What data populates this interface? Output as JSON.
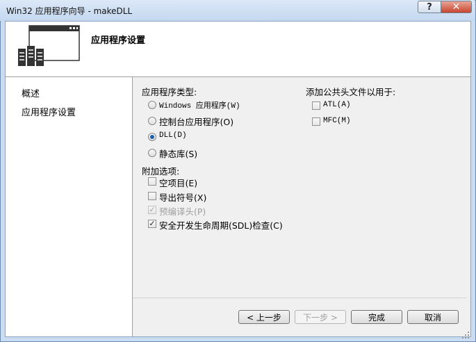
{
  "window": {
    "title": "Win32 应用程序向导 - makeDLL",
    "help_glyph": "?",
    "close_glyph": "✕"
  },
  "header": {
    "title": "应用程序设置"
  },
  "nav": {
    "items": [
      "概述",
      "应用程序设置"
    ]
  },
  "app_type": {
    "label": "应用程序类型:",
    "options": [
      {
        "label": "Windows 应用程序(W)",
        "selected": false
      },
      {
        "label": "控制台应用程序(O)",
        "selected": false
      },
      {
        "label": "DLL(D)",
        "selected": true
      },
      {
        "label": "静态库(S)",
        "selected": false
      }
    ]
  },
  "extra": {
    "label": "附加选项:",
    "options": [
      {
        "label": "空项目(E)",
        "checked": false,
        "enabled": true
      },
      {
        "label": "导出符号(X)",
        "checked": false,
        "enabled": true
      },
      {
        "label": "预编译头(P)",
        "checked": true,
        "enabled": false
      },
      {
        "label": "安全开发生命周期(SDL)检查(C)",
        "checked": true,
        "enabled": true
      }
    ]
  },
  "common_headers": {
    "label": "添加公共头文件以用于:",
    "options": [
      {
        "label": "ATL(A)",
        "checked": false
      },
      {
        "label": "MFC(M)",
        "checked": false
      }
    ]
  },
  "buttons": {
    "prev": "< 上一步",
    "next": "下一步 >",
    "finish": "完成",
    "cancel": "取消"
  }
}
